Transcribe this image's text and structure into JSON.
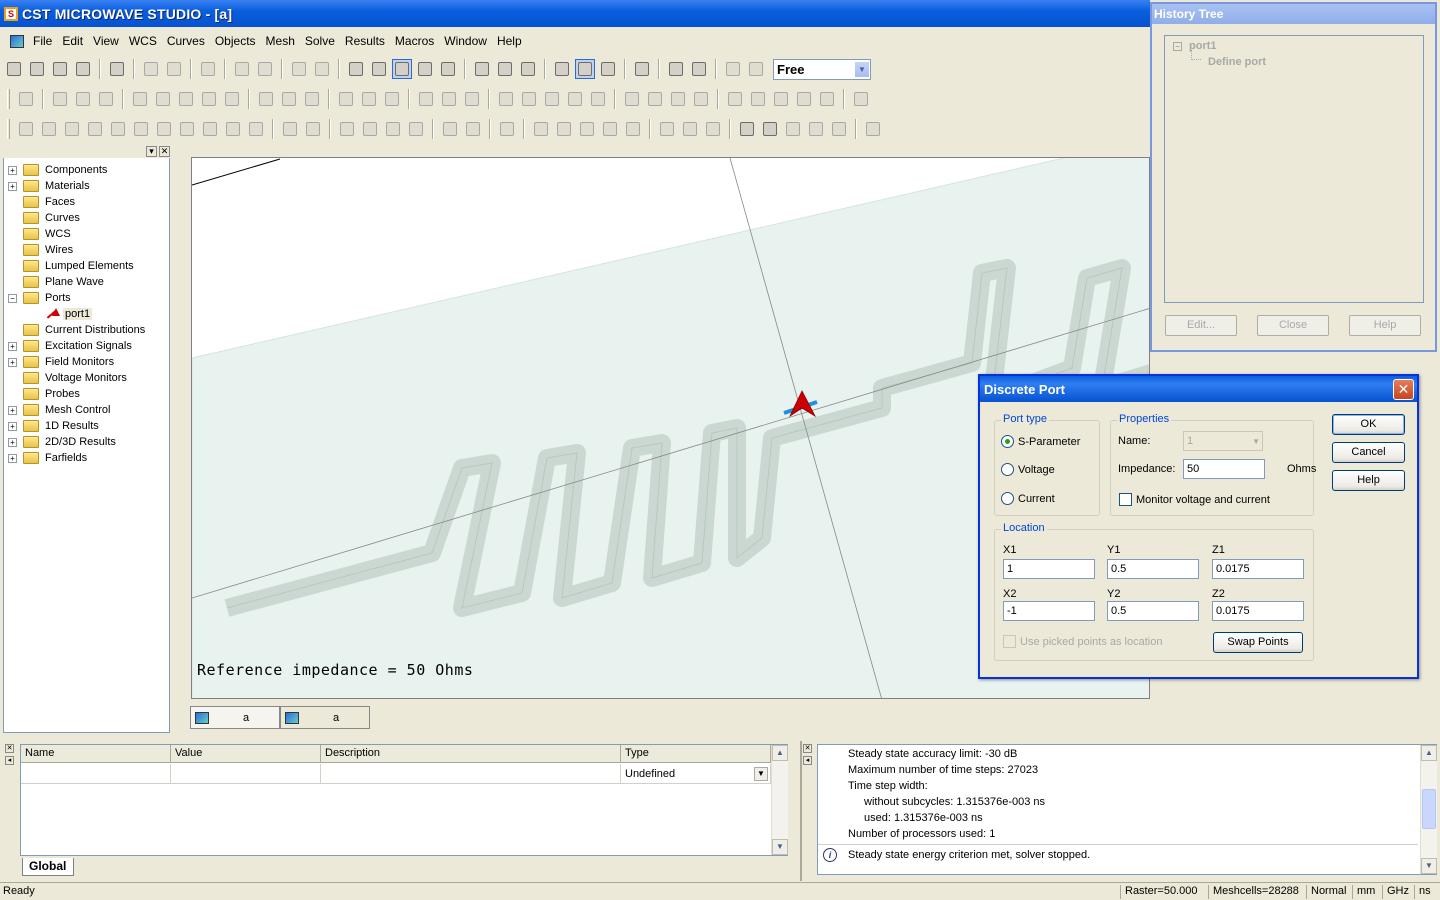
{
  "window": {
    "title": "CST MICROWAVE STUDIO - [a]"
  },
  "menu": [
    "File",
    "Edit",
    "View",
    "WCS",
    "Curves",
    "Objects",
    "Mesh",
    "Solve",
    "Results",
    "Macros",
    "Window",
    "Help"
  ],
  "toolbar": {
    "view_mode": "Free"
  },
  "nav_tree": {
    "items": [
      {
        "label": "Components",
        "expander": "+"
      },
      {
        "label": "Materials",
        "expander": "+"
      },
      {
        "label": "Faces",
        "expander": ""
      },
      {
        "label": "Curves",
        "expander": ""
      },
      {
        "label": "WCS",
        "expander": ""
      },
      {
        "label": "Wires",
        "expander": ""
      },
      {
        "label": "Lumped Elements",
        "expander": ""
      },
      {
        "label": "Plane Wave",
        "expander": ""
      },
      {
        "label": "Ports",
        "expander": "−"
      },
      {
        "label": "port1",
        "expander": "",
        "child": true
      },
      {
        "label": "Current Distributions",
        "expander": ""
      },
      {
        "label": "Excitation Signals",
        "expander": "+"
      },
      {
        "label": "Field Monitors",
        "expander": "+"
      },
      {
        "label": "Voltage Monitors",
        "expander": ""
      },
      {
        "label": "Probes",
        "expander": ""
      },
      {
        "label": "Mesh Control",
        "expander": "+"
      },
      {
        "label": "1D Results",
        "expander": "+"
      },
      {
        "label": "2D/3D Results",
        "expander": "+"
      },
      {
        "label": "Farfields",
        "expander": "+"
      }
    ]
  },
  "viewport": {
    "reference_text": "Reference impedance = 50 Ohms",
    "doc_tabs": [
      "a",
      "a"
    ]
  },
  "history": {
    "title": "History Tree",
    "root": "port1",
    "child": "Define port",
    "buttons": {
      "edit": "Edit...",
      "close": "Close",
      "help": "Help"
    }
  },
  "dialog": {
    "title": "Discrete Port",
    "port_type": {
      "legend": "Port type",
      "options": [
        "S-Parameter",
        "Voltage",
        "Current"
      ],
      "selected": "S-Parameter"
    },
    "properties": {
      "legend": "Properties",
      "name_label": "Name:",
      "name_value": "1",
      "impedance_label": "Impedance:",
      "impedance_value": "50",
      "impedance_unit": "Ohms",
      "monitor_label": "Monitor voltage and current"
    },
    "location": {
      "legend": "Location",
      "x1_label": "X1",
      "x1": "1",
      "y1_label": "Y1",
      "y1": "0.5",
      "z1_label": "Z1",
      "z1": "0.0175",
      "x2_label": "X2",
      "x2": "-1",
      "y2_label": "Y2",
      "y2": "0.5",
      "z2_label": "Z2",
      "z2": "0.0175",
      "use_picked_label": "Use picked points as location",
      "swap_label": "Swap Points"
    },
    "buttons": {
      "ok": "OK",
      "cancel": "Cancel",
      "help": "Help"
    }
  },
  "params": {
    "columns": [
      "Name",
      "Value",
      "Description",
      "Type"
    ],
    "row": {
      "type": "Undefined"
    },
    "tab": "Global"
  },
  "messages": {
    "lines": [
      "Steady state accuracy limit: -30 dB",
      "Maximum number of time steps: 27023",
      "Time step width:",
      "without subcycles: 1.315376e-003 ns",
      "used: 1.315376e-003 ns",
      "Number of processors used: 1"
    ],
    "info_line": "Steady state energy criterion met, solver stopped."
  },
  "status": {
    "text": "Ready",
    "raster": "Raster=50.000",
    "meshcells": "Meshcells=28288",
    "mode": "Normal",
    "unit_length": "mm",
    "unit_freq": "GHz",
    "unit_time": "ns"
  },
  "colors": {
    "xp_blue": "#0a5fde",
    "substrate": "#e8f2ee",
    "trace": "#cbd8d1",
    "port_red": "#cc0000"
  }
}
